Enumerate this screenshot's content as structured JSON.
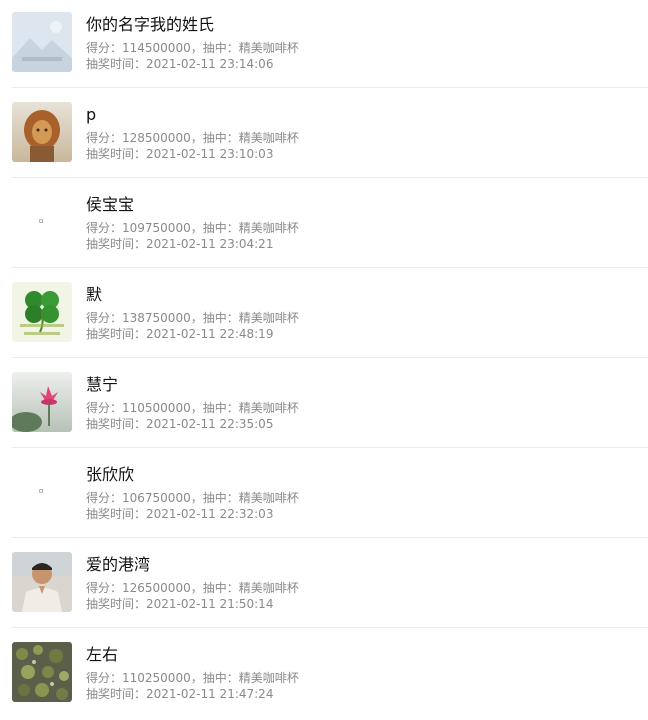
{
  "records": [
    {
      "name": "你的名字我的姓氏",
      "score_line": "得分：114500000，抽中：精美咖啡杯",
      "time_line": "抽奖时间：2021-02-11 23:14:06",
      "avatar": "placeholder-image-icon"
    },
    {
      "name": "p",
      "score_line": "得分：128500000，抽中：精美咖啡杯",
      "time_line": "抽奖时间：2021-02-11 23:10:03",
      "avatar": "lion-photo"
    },
    {
      "name": "侯宝宝",
      "score_line": "得分：109750000，抽中：精美咖啡杯",
      "time_line": "抽奖时间：2021-02-11 23:04:21",
      "avatar": "broken-image-icon"
    },
    {
      "name": "默",
      "score_line": "得分：138750000，抽中：精美咖啡杯",
      "time_line": "抽奖时间：2021-02-11 22:48:19",
      "avatar": "clover-photo"
    },
    {
      "name": "慧宁",
      "score_line": "得分：110500000，抽中：精美咖啡杯",
      "time_line": "抽奖时间：2021-02-11 22:35:05",
      "avatar": "lotus-photo"
    },
    {
      "name": "张欣欣",
      "score_line": "得分：106750000，抽中：精美咖啡杯",
      "time_line": "抽奖时间：2021-02-11 22:32:03",
      "avatar": "broken-image-icon"
    },
    {
      "name": "爱的港湾",
      "score_line": "得分：126500000，抽中：精美咖啡杯",
      "time_line": "抽奖时间：2021-02-11 21:50:14",
      "avatar": "man-portrait-photo"
    },
    {
      "name": "左右",
      "score_line": "得分：110250000，抽中：精美咖啡杯",
      "time_line": "抽奖时间：2021-02-11 21:47:24",
      "avatar": "moss-texture-photo"
    }
  ]
}
